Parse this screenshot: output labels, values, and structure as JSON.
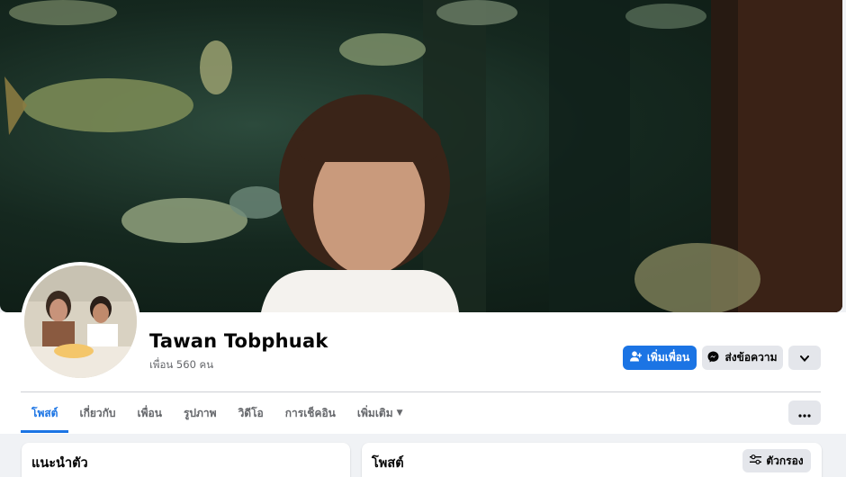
{
  "profile": {
    "name": "Tawan Tobphuak",
    "friends_count": "เพื่อน 560 คน"
  },
  "actions": {
    "add_friend_label": "เพิ่มเพื่อน",
    "message_label": "ส่งข้อความ"
  },
  "tabs": [
    {
      "label": "โพสต์"
    },
    {
      "label": "เกี่ยวกับ"
    },
    {
      "label": "เพื่อน"
    },
    {
      "label": "รูปภาพ"
    },
    {
      "label": "วิดีโอ"
    },
    {
      "label": "การเช็คอิน"
    },
    {
      "label": "เพิ่มเติม"
    }
  ],
  "intro": {
    "title": "แนะนำตัว"
  },
  "posts": {
    "title": "โพสต์",
    "filter_label": "ตัวกรอง"
  },
  "colors": {
    "accent": "#1b74e4",
    "button_gray": "#e4e6eb",
    "page_bg": "#f0f2f5"
  },
  "icons": {
    "add_friend": "person-plus-icon",
    "message": "messenger-icon",
    "more": "chevron-down-icon",
    "tab_more": "ellipsis-icon",
    "filter": "sliders-icon",
    "more_caret": "caret-down-icon"
  }
}
